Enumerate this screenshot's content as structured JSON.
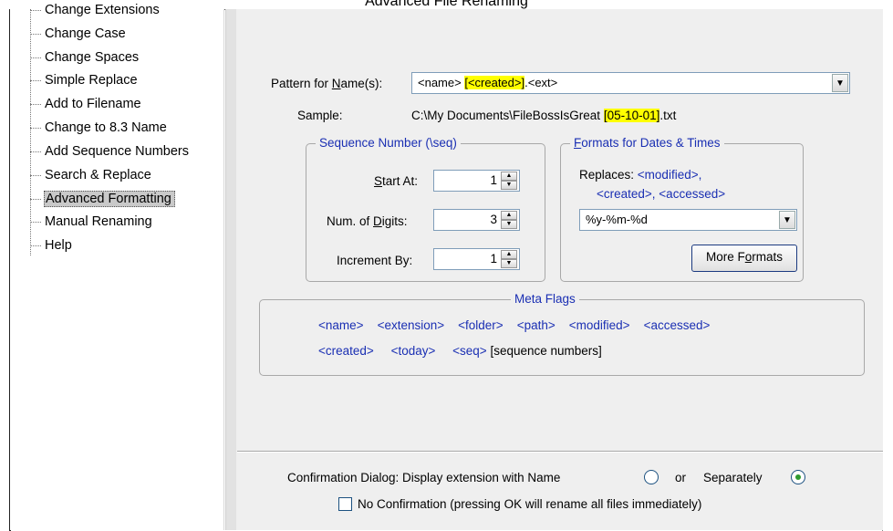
{
  "window": {
    "title": "Advanced File Renaming"
  },
  "sidebar": {
    "items": [
      {
        "label": "Change Extensions",
        "selected": false
      },
      {
        "label": "Change Case",
        "selected": false
      },
      {
        "label": "Change Spaces",
        "selected": false
      },
      {
        "label": "Simple Replace",
        "selected": false
      },
      {
        "label": "Add to Filename",
        "selected": false
      },
      {
        "label": "Change to 8.3 Name",
        "selected": false
      },
      {
        "label": "Add Sequence Numbers",
        "selected": false
      },
      {
        "label": "Search & Replace",
        "selected": false
      },
      {
        "label": "Advanced Formatting",
        "selected": true
      },
      {
        "label": "Manual Renaming",
        "selected": false
      },
      {
        "label": "Help",
        "selected": false
      }
    ]
  },
  "pattern": {
    "label_pre": "Pattern for ",
    "label_key": "N",
    "label_post": "ame(s):",
    "value_pre": "<name> ",
    "value_hl": "[<created>]",
    "value_post": ".<ext>"
  },
  "sample": {
    "label": "Sample:",
    "value_pre": "C:\\My Documents\\FileBossIsGreat ",
    "value_hl": "[05-10-01]",
    "value_post": ".txt"
  },
  "sequence": {
    "title": "Sequence Number (\\seq)",
    "start_label_key": "S",
    "start_label_rest": "tart At:",
    "start_value": "1",
    "digits_label_pre": "Num. of ",
    "digits_label_key": "D",
    "digits_label_post": "igits:",
    "digits_value": "3",
    "increment_label": "Increment By:",
    "increment_value": "1"
  },
  "formats": {
    "title_key": "F",
    "title_rest": "ormats for Dates & Times",
    "replaces_label": "Replaces: ",
    "replaces_line1": "<modified>,",
    "replaces_line2": "<created>, <accessed>",
    "format_value": "%y-%m-%d",
    "more_pre": "More F",
    "more_key": "o",
    "more_post": "rmats"
  },
  "meta_flags": {
    "title": "Meta Flags",
    "row1": [
      "<name>",
      "<extension>",
      "<folder>",
      "<path>",
      "<modified>",
      "<accessed>"
    ],
    "row2": [
      "<created>",
      "<today>",
      "<seq>"
    ],
    "seq_note": "[sequence numbers]"
  },
  "confirmation": {
    "label": "Confirmation Dialog: Display extension with Name",
    "or_label": "or",
    "separately_label": "Separately",
    "selected": "separately",
    "no_confirm_label": "No Confirmation (pressing OK will rename all files immediately)",
    "no_confirm_checked": false
  },
  "colors": {
    "accent": "#1a2fb3",
    "highlight": "#ffff00",
    "selected_radio": "#2f9a2f"
  }
}
